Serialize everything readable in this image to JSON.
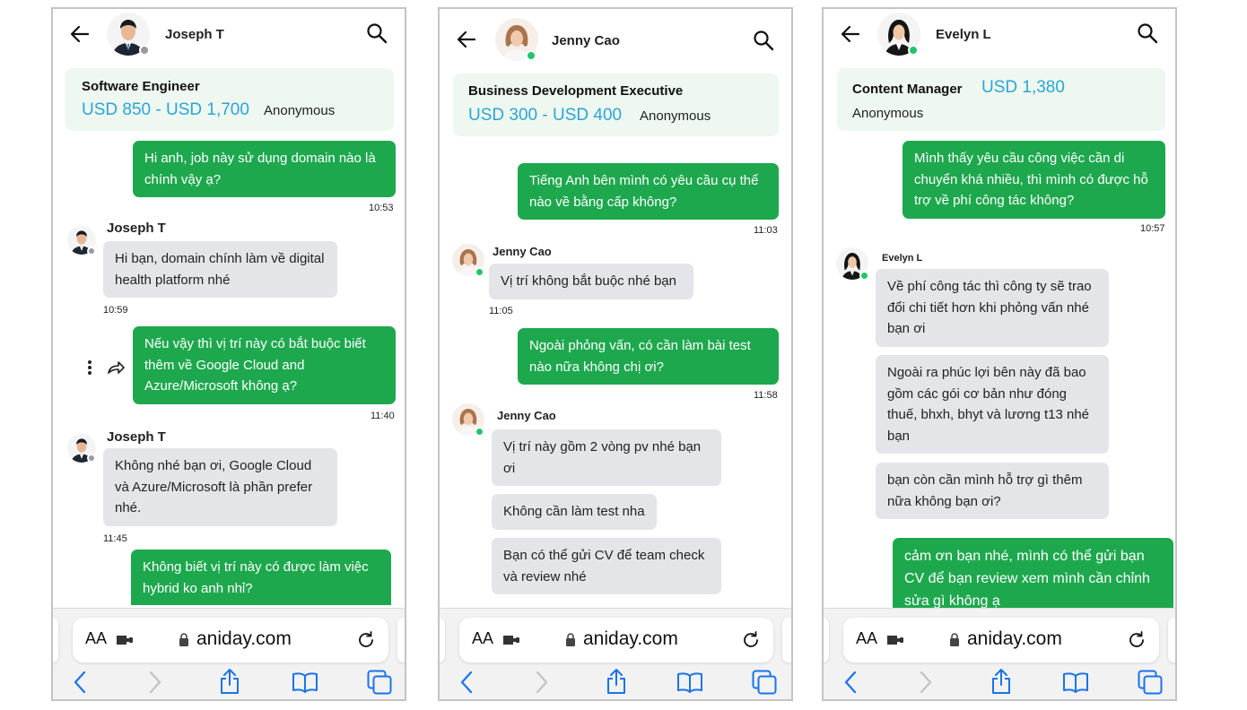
{
  "browser": {
    "text_size_label": "AA",
    "url": "aniday.com"
  },
  "panels": [
    {
      "contact": "Joseph T",
      "job": {
        "title": "Software Engineer",
        "salary": "USD 850 - USD 1,700",
        "visibility": "Anonymous"
      },
      "messages": [
        {
          "dir": "out",
          "text": "Hi anh, job này sử dụng domain nào là chính vậy ạ?",
          "time": "10:53"
        },
        {
          "dir": "in",
          "sender": "Joseph T",
          "text": "Hi bạn, domain chính làm về digital health platform nhé",
          "time": "10:59"
        },
        {
          "dir": "out",
          "text": "Nếu vậy thì vị trí này có bắt buộc biết thêm về Google Cloud and Azure/Microsoft không ạ?",
          "time": "11:40"
        },
        {
          "dir": "in",
          "sender": "Joseph T",
          "text": "Không nhé bạn ơi, Google Cloud và Azure/Microsoft là phần prefer nhé.",
          "time": "11:45"
        },
        {
          "dir": "out",
          "text": "Không biết vị trí này có được làm việc hybrid ko anh nhỉ?",
          "time": ""
        }
      ]
    },
    {
      "contact": "Jenny Cao",
      "job": {
        "title": "Business Development Executive",
        "salary": "USD 300 - USD 400",
        "visibility": "Anonymous"
      },
      "messages": [
        {
          "dir": "out",
          "text": "Tiếng Anh bên mình có yêu cầu cụ thể nào về bằng cấp không?",
          "time": "11:03"
        },
        {
          "dir": "in",
          "sender": "Jenny Cao",
          "text": "Vị trí không bắt buộc nhé bạn",
          "time": "11:05"
        },
        {
          "dir": "out",
          "text": "Ngoài phỏng vấn, có cần làm bài test nào nữa không chị ơi?",
          "time": "11:58"
        },
        {
          "dir": "in",
          "sender": "Jenny Cao",
          "text": "Vị trí này gồm 2 vòng pv nhé bạn ơi",
          "time": ""
        },
        {
          "dir": "in",
          "text": "Không cần làm test nha",
          "time": ""
        },
        {
          "dir": "in",
          "text": "Bạn có thể gửi CV để team check và review nhé",
          "time": ""
        }
      ]
    },
    {
      "contact": "Evelyn L",
      "job": {
        "title": "Content Manager",
        "salary": "USD 1,380",
        "visibility": "Anonymous"
      },
      "messages": [
        {
          "dir": "out",
          "text": "Mình thấy yêu cầu công việc cần di chuyển khá nhiều, thì mình có được hỗ trợ về phí công tác không?",
          "time": "10:57"
        },
        {
          "dir": "in",
          "sender": "Evelyn L",
          "text": "Về phí công tác thì công ty sẽ trao đổi chi tiết hơn khi phỏng vấn nhé bạn ơi",
          "time": ""
        },
        {
          "dir": "in",
          "text": "Ngoài ra phúc lợi bên này đã bao gồm các gói cơ bản như đóng thuế, bhxh, bhyt và lương t13 nhé bạn",
          "time": ""
        },
        {
          "dir": "in",
          "text": "bạn còn cần mình hỗ trợ gì thêm nữa không bạn ơi?",
          "time": ""
        },
        {
          "dir": "out",
          "text": "cảm ơn bạn nhé, mình có thể gửi bạn CV để bạn review xem mình cần chỉnh sửa gì không ạ",
          "time": ""
        }
      ]
    }
  ],
  "icons": {
    "back": "arrow-left-icon",
    "search": "magnifier-icon",
    "more": "kebab-icon",
    "forward": "forward-arrow-icon",
    "lock": "lock-icon",
    "reload": "reload-icon",
    "extension": "extension-icon",
    "nav_back": "chevron-left-icon",
    "nav_forward": "chevron-right-icon",
    "share": "share-icon",
    "bookmarks": "book-icon",
    "tabs": "tabs-icon"
  },
  "colors": {
    "outgoing_bubble": "#1ea84e",
    "incoming_bubble": "#e3e5e8",
    "salary": "#2aa6d6",
    "job_card": "#eef7f0",
    "online": "#23c56b",
    "offline": "#9a9a9a",
    "toolbar_icon": "#1a73e8"
  }
}
